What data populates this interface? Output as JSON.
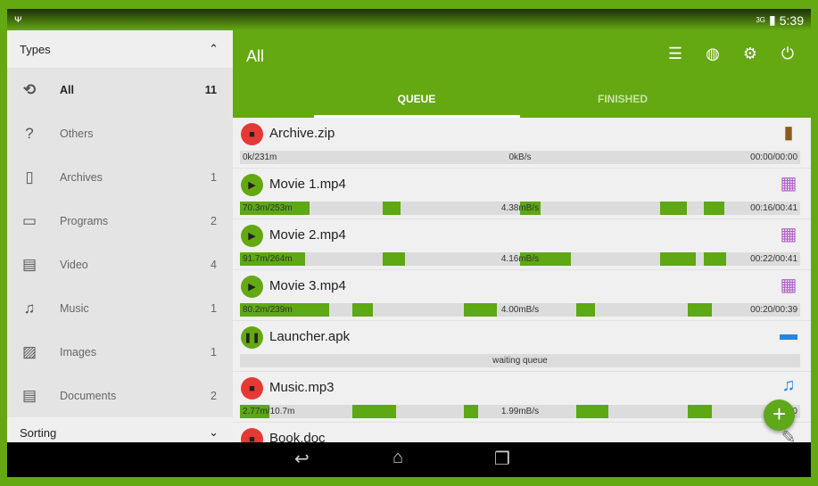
{
  "status": {
    "left_icon": "usb-debug-icon",
    "network": "3G",
    "time": "5:39"
  },
  "sidebar": {
    "types_label": "Types",
    "items": [
      {
        "icon": "refresh-icon",
        "glyph": "⟲",
        "label": "All",
        "count": "11"
      },
      {
        "icon": "help-icon",
        "glyph": "?",
        "label": "Others",
        "count": ""
      },
      {
        "icon": "archive-icon",
        "glyph": "▯",
        "label": "Archives",
        "count": "1"
      },
      {
        "icon": "monitor-icon",
        "glyph": "▭",
        "label": "Programs",
        "count": "2"
      },
      {
        "icon": "film-icon",
        "glyph": "▤",
        "label": "Video",
        "count": "4"
      },
      {
        "icon": "music-icon",
        "glyph": "♫",
        "label": "Music",
        "count": "1"
      },
      {
        "icon": "image-icon",
        "glyph": "▨",
        "label": "Images",
        "count": "1"
      },
      {
        "icon": "document-icon",
        "glyph": "▤",
        "label": "Documents",
        "count": "2"
      }
    ],
    "sorting_label": "Sorting"
  },
  "header": {
    "title": "All",
    "tabs": [
      "QUEUE",
      "FINISHED"
    ],
    "active_tab": "QUEUE"
  },
  "colors": {
    "accent": "#64a812",
    "progress": "#5da813",
    "stop": "#e53935"
  },
  "downloads": [
    {
      "name": "Archive.zip",
      "state": "stopped",
      "type": "archive",
      "size": "0k/231m",
      "speed": "0kB/s",
      "time": "00:00/00:00",
      "segments": []
    },
    {
      "name": "Movie 1.mp4",
      "state": "paused",
      "type": "video",
      "size": "70.3m/253m",
      "speed": "4.38mB/s",
      "time": "00:16/00:41",
      "segments": [
        [
          0,
          0.124
        ],
        [
          0.255,
          0.287
        ],
        [
          0.5,
          0.537
        ],
        [
          0.75,
          0.798
        ],
        [
          0.828,
          0.865
        ]
      ]
    },
    {
      "name": "Movie 2.mp4",
      "state": "paused",
      "type": "video",
      "size": "91.7m/264m",
      "speed": "4.16mB/s",
      "time": "00:22/00:41",
      "segments": [
        [
          0,
          0.116
        ],
        [
          0.255,
          0.295
        ],
        [
          0.5,
          0.591
        ],
        [
          0.75,
          0.813
        ],
        [
          0.828,
          0.868
        ]
      ]
    },
    {
      "name": "Movie 3.mp4",
      "state": "paused",
      "type": "video",
      "size": "80.2m/239m",
      "speed": "4.00mB/s",
      "time": "00:20/00:39",
      "segments": [
        [
          0,
          0.159
        ],
        [
          0.201,
          0.237
        ],
        [
          0.4,
          0.459
        ],
        [
          0.6,
          0.634
        ],
        [
          0.8,
          0.843
        ]
      ]
    },
    {
      "name": "Launcher.apk",
      "state": "queued",
      "type": "program",
      "status_text": "waiting queue"
    },
    {
      "name": "Music.mp3",
      "state": "stopped",
      "type": "music",
      "size": "2.77m/10.7m",
      "speed": "1.99mB/s",
      "time": "00:0",
      "segments": [
        [
          0,
          0.053
        ],
        [
          0.201,
          0.279
        ],
        [
          0.4,
          0.425
        ],
        [
          0.6,
          0.658
        ],
        [
          0.8,
          0.842
        ]
      ]
    },
    {
      "name": "Book.doc",
      "state": "stopped",
      "type": "document"
    }
  ],
  "fab": "+"
}
